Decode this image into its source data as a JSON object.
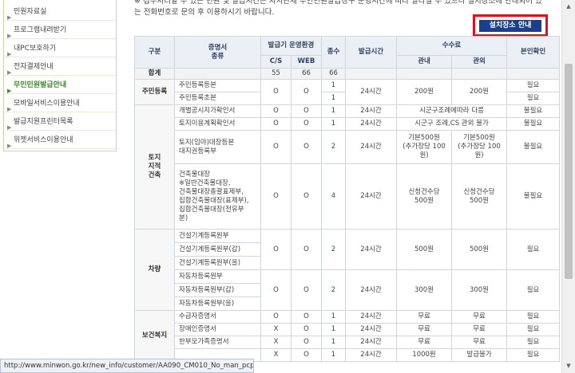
{
  "sidebar": {
    "items": [
      {
        "label": "민원자료실",
        "active": false
      },
      {
        "label": "프로그램내려받기",
        "active": false
      },
      {
        "label": "내PC보호하기",
        "active": false
      },
      {
        "label": "전자결제안내",
        "active": false
      },
      {
        "label": "무인민원발급안내",
        "active": true
      },
      {
        "label": "모바일서비스이용안내",
        "active": false
      },
      {
        "label": "발급지원프린터목록",
        "active": false
      },
      {
        "label": "위젯서비스이용안내",
        "active": false
      }
    ]
  },
  "notice": {
    "line1": "※ 접수처리할 수 있는 민원 및 발급시간은 자치단체 무인민원발급창구 운영시간에 따라 달라질 수 있으니 설치장소에 안내되어 있",
    "line2": "는 전화번호로 문의 후 이용하시기 바랍니다."
  },
  "install_button": {
    "label": "설치장소 안내"
  },
  "table": {
    "headers": {
      "category": "구분",
      "certificate": "증명서\n종류",
      "env": "발급기 운영환경",
      "cs": "C/S",
      "web": "WEB",
      "count": "종수",
      "hours": "발급시간",
      "fee": "수수료",
      "fee_guide": "관내",
      "fee_outside": "관외",
      "identity": "본인확인"
    },
    "total": {
      "label": "합계",
      "cs": "55",
      "web": "66",
      "count": "66"
    },
    "rows": {
      "r1": {
        "category": "주민등록",
        "cert": "주민등록등본",
        "cs": "O",
        "web": "O",
        "count": "1",
        "hours": "24시간",
        "fee_in": "200원",
        "fee_out": "200원",
        "identity": "필요"
      },
      "r2": {
        "cert": "주민등록초본",
        "count": "1",
        "identity": "필요"
      },
      "r3": {
        "category": "토지\n지적\n건축",
        "cert": "개별공시지가확인서",
        "cs": "O",
        "web": "O",
        "count": "1",
        "hours": "24시간",
        "fee_in": "시군구조례에따라 다름",
        "identity": "불필요"
      },
      "r4": {
        "cert": "토지이용계획확인서",
        "cs": "O",
        "web": "O",
        "count": "1",
        "hours": "24시간",
        "fee_in": "시군구 조례,CS 관외 불가",
        "identity": "불필요"
      },
      "r5": {
        "cert": "토지(임야)대장등본\n대지권등록부",
        "cs": "O",
        "web": "O",
        "count": "2",
        "hours": "24시간",
        "fee_in": "기본500원\n(추가장당 100\n원)",
        "fee_out": "기본500원\n(추가장당 100\n원)",
        "identity": "불필요"
      },
      "r6": {
        "cert": "건축물대장\n※일반건축물대장,\n건축물대장총괄표제부,\n집합건축물대장(표제부),\n집합건축물대장(전유부\n분)",
        "cs": "O",
        "web": "O",
        "count": "4",
        "hours": "24시간",
        "fee_in": "신청건수당\n500원",
        "fee_out": "신청건수당\n500원",
        "identity": "불필요"
      },
      "r7": {
        "category": "차량",
        "cert": "건설기계등록원부",
        "cs": "O",
        "web": "O",
        "count": "2",
        "hours": "24시간",
        "fee_in": "500원",
        "fee_out": "500원",
        "identity": "필요"
      },
      "r8": {
        "cert": "건설기계등록원부(갑)"
      },
      "r9": {
        "cert": "건설기계등록원부(을)"
      },
      "r10": {
        "cert": "자동차등록원부",
        "cs": "O",
        "web": "O",
        "count": "2",
        "hours": "24시간",
        "fee_in": "300원",
        "fee_out": "300원",
        "identity": "필요"
      },
      "r11": {
        "cert": "자동차등록원부(갑)"
      },
      "r12": {
        "cert": "자동차등록원부(을)"
      },
      "r13": {
        "category": "보건복지",
        "cert": "수급자증명서",
        "cs": "O",
        "web": "O",
        "count": "1",
        "hours": "24시간",
        "fee_in": "무료",
        "fee_out": "무료",
        "identity": "필요"
      },
      "r14": {
        "cert": "장애인증명서",
        "cs": "X",
        "web": "O",
        "count": "1",
        "hours": "24시간",
        "fee_in": "무료",
        "fee_out": "무료",
        "identity": "필요"
      },
      "r15": {
        "cert": "한부모가족증명서",
        "cs": "X",
        "web": "O",
        "count": "1",
        "hours": "24시간",
        "fee_in": "무료",
        "fee_out": "무료",
        "identity": "필요"
      },
      "r16": {
        "cs": "X",
        "web": "O",
        "count": "1",
        "hours": "24시간",
        "fee_in": "1000원",
        "fee_out": "발급불가",
        "identity": "필요"
      }
    }
  },
  "statusbar": {
    "text": "http://www.minwon.go.kr/new_info/customer/AA090_CM010_No_man_pcpup.jsp"
  }
}
